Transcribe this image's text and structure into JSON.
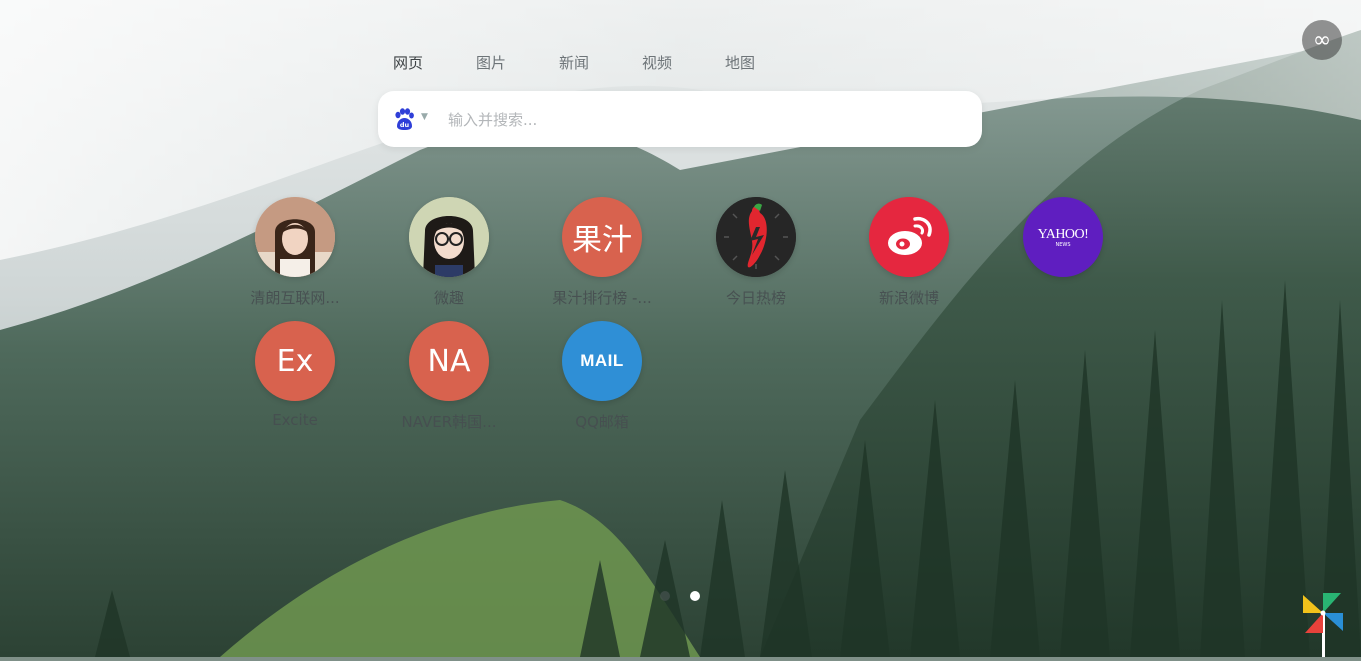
{
  "tabs": [
    {
      "label": "网页",
      "active": true
    },
    {
      "label": "图片",
      "active": false
    },
    {
      "label": "新闻",
      "active": false
    },
    {
      "label": "视频",
      "active": false
    },
    {
      "label": "地图",
      "active": false
    }
  ],
  "search": {
    "engine_icon": "baidu-paw-icon",
    "placeholder": "输入并搜索..."
  },
  "shortcuts": [
    {
      "label": "清朗互联网...",
      "icon": "avatar-girl-1",
      "color": "#c9a38c"
    },
    {
      "label": "微趣",
      "icon": "avatar-girl-glasses",
      "color": "#b8c29a"
    },
    {
      "label": "果汁排行榜 -...",
      "icon_text": "果汁",
      "color": "#d8624e"
    },
    {
      "label": "今日热榜",
      "icon": "chili-pepper-icon",
      "color": "#2a2a2a"
    },
    {
      "label": "新浪微博",
      "icon": "weibo-icon",
      "color": "#e5273f"
    },
    {
      "label": "",
      "icon_text": "YAHOO!",
      "icon_sub": "NEWS",
      "color": "#5f1ec0"
    },
    {
      "label": "Excite",
      "icon_text": "Ex",
      "color": "#d8624e"
    },
    {
      "label": "NAVER韩国...",
      "icon_text": "NA",
      "color": "#d8624e"
    },
    {
      "label": "QQ邮箱",
      "icon_text": "MAIL",
      "color": "#2f8fd6"
    }
  ],
  "pagination": {
    "pages": 2,
    "current": 2
  },
  "top_right": {
    "icon": "infinity-icon"
  },
  "bottom_right": {
    "icon": "pinwheel-icon"
  }
}
